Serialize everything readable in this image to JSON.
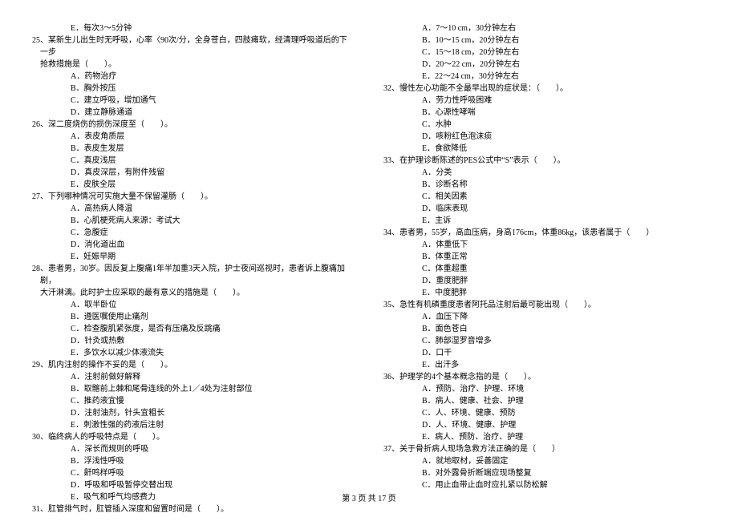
{
  "left": {
    "line0": "E．每次3～5分钟",
    "q25": {
      "stem1": "25、某新生儿出生时无呼吸，心率〈90次/分，全身苍白，四肢瘫软，经清理呼吸道后的下一步",
      "stem2": "抢救措施是（　　）。",
      "A": "A．药物治疗",
      "B": "B．胸外按压",
      "C": "C．建立呼吸，增加通气",
      "D": "D．建立静脉通道"
    },
    "q26": {
      "stem": "26、深二度烧伤的损伤深度至（　　）。",
      "A": "A．表皮角质层",
      "B": "B．表皮生发层",
      "C": "C．真皮浅层",
      "D": "D．真皮深层，有附件残留",
      "E": "E．皮肤全层"
    },
    "q27": {
      "stem": "27、下列哪种情况可实施大量不保留灌肠（　　）。",
      "A": "A．高热病人降温",
      "B": "B．心肌梗死病人来源：考试大",
      "C": "C．急腹症",
      "D": "D．消化道出血",
      "E": "E．妊娠早期"
    },
    "q28": {
      "stem1": "28、患者男，30岁。因反复上腹痛1年半加重3天入院，护士夜间巡视时，患者诉上腹痛加剧，",
      "stem2": "大汗淋漓。此时护士应采取的最有意义的措施是（　　）。",
      "A": "A．取半卧位",
      "B": "B．遵医嘱使用止痛剂",
      "C": "C．检查腹肌紧张度，是否有压痛及反跳痛",
      "D": "D．针灸或热敷",
      "E": "E．多饮水以减少体液流失"
    },
    "q29": {
      "stem": "29、肌内注射的操作不妥的是（　　）。",
      "A": "A．注射前做好解释",
      "B": "B．取髂前上棘和尾骨连线的外上1／4处为注射部位",
      "C": "C．推药液宜慢",
      "D": "D．注射油剂，针头宜粗长",
      "E": "E．刺激性强的药液后注射"
    },
    "q30": {
      "stem": "30、临终病人的呼吸特点是（　　）。",
      "A": "A．深长而规则的呼吸",
      "B": "B．浮浅性呼吸",
      "C": "C．鼾鸣样呼吸",
      "D": "D．呼吸和呼吸暂停交替出现",
      "E": "E．吸气和呼气均感费力"
    },
    "q31": {
      "stem": "31、肛管排气时，肛管插入深度和留置时间是（　　）。"
    }
  },
  "right": {
    "q31opts": {
      "A": "A．7～10 cm，30分钟左右",
      "B": "B．10～15 cm，20分钟左右",
      "C": "C．15～18 cm，20分钟左右",
      "D": "D．20～22 cm，20分钟左右",
      "E": "E．22～24 cm，30分钟左右"
    },
    "q32": {
      "stem": "32、慢性左心功能不全最早出现的症状是：（　　）。",
      "A": "A．劳力性呼吸困难",
      "B": "B．心源性哮喘",
      "C": "C．水肿",
      "D": "D．咳粉红色泡沫痰",
      "E": "E．食欲降低"
    },
    "q33": {
      "stem": "33、在护理诊断陈述的PES公式中“S”表示（　　）。",
      "A": "A．分类",
      "B": "B．诊断名称",
      "C": "C．相关因素",
      "D": "D．临床表现",
      "E": "E．主诉"
    },
    "q34": {
      "stem": "34、患者男，55岁，高血压病，身高176cm，体重86kg，该患者属于（　　）",
      "A": "A．体重低下",
      "B": "B．体重正常",
      "C": "C．体重超重",
      "D": "D．重度肥胖",
      "E": "E．中度肥胖"
    },
    "q35": {
      "stem": "35、急性有机磷重度患者阿托品注射后最可能出现（　　）。",
      "A": "A．血压下降",
      "B": "B．面色苍白",
      "C": "C．肺部湿罗音增多",
      "D": "D．口干",
      "E": "E．出汗多"
    },
    "q36": {
      "stem": "36、护理学的4个基本概念指的是（　　）。",
      "A": "A．预防、治疗、护理、环境",
      "B": "B．病人、健康、社会、护理",
      "C": "C．人、环境、健康、预防",
      "D": "D．人、环境、健康、护理",
      "E": "E．病人、预防、治疗、护理"
    },
    "q37": {
      "stem": "37、关于骨折病人现场急救方法正确的是（　　）",
      "A": "A．就地取材，妥善固定",
      "B": "B．对外露骨折断端应现场整复",
      "C": "C．用止血带止血时应扎紧以防松解"
    }
  },
  "footer": "第 3 页 共 17 页"
}
